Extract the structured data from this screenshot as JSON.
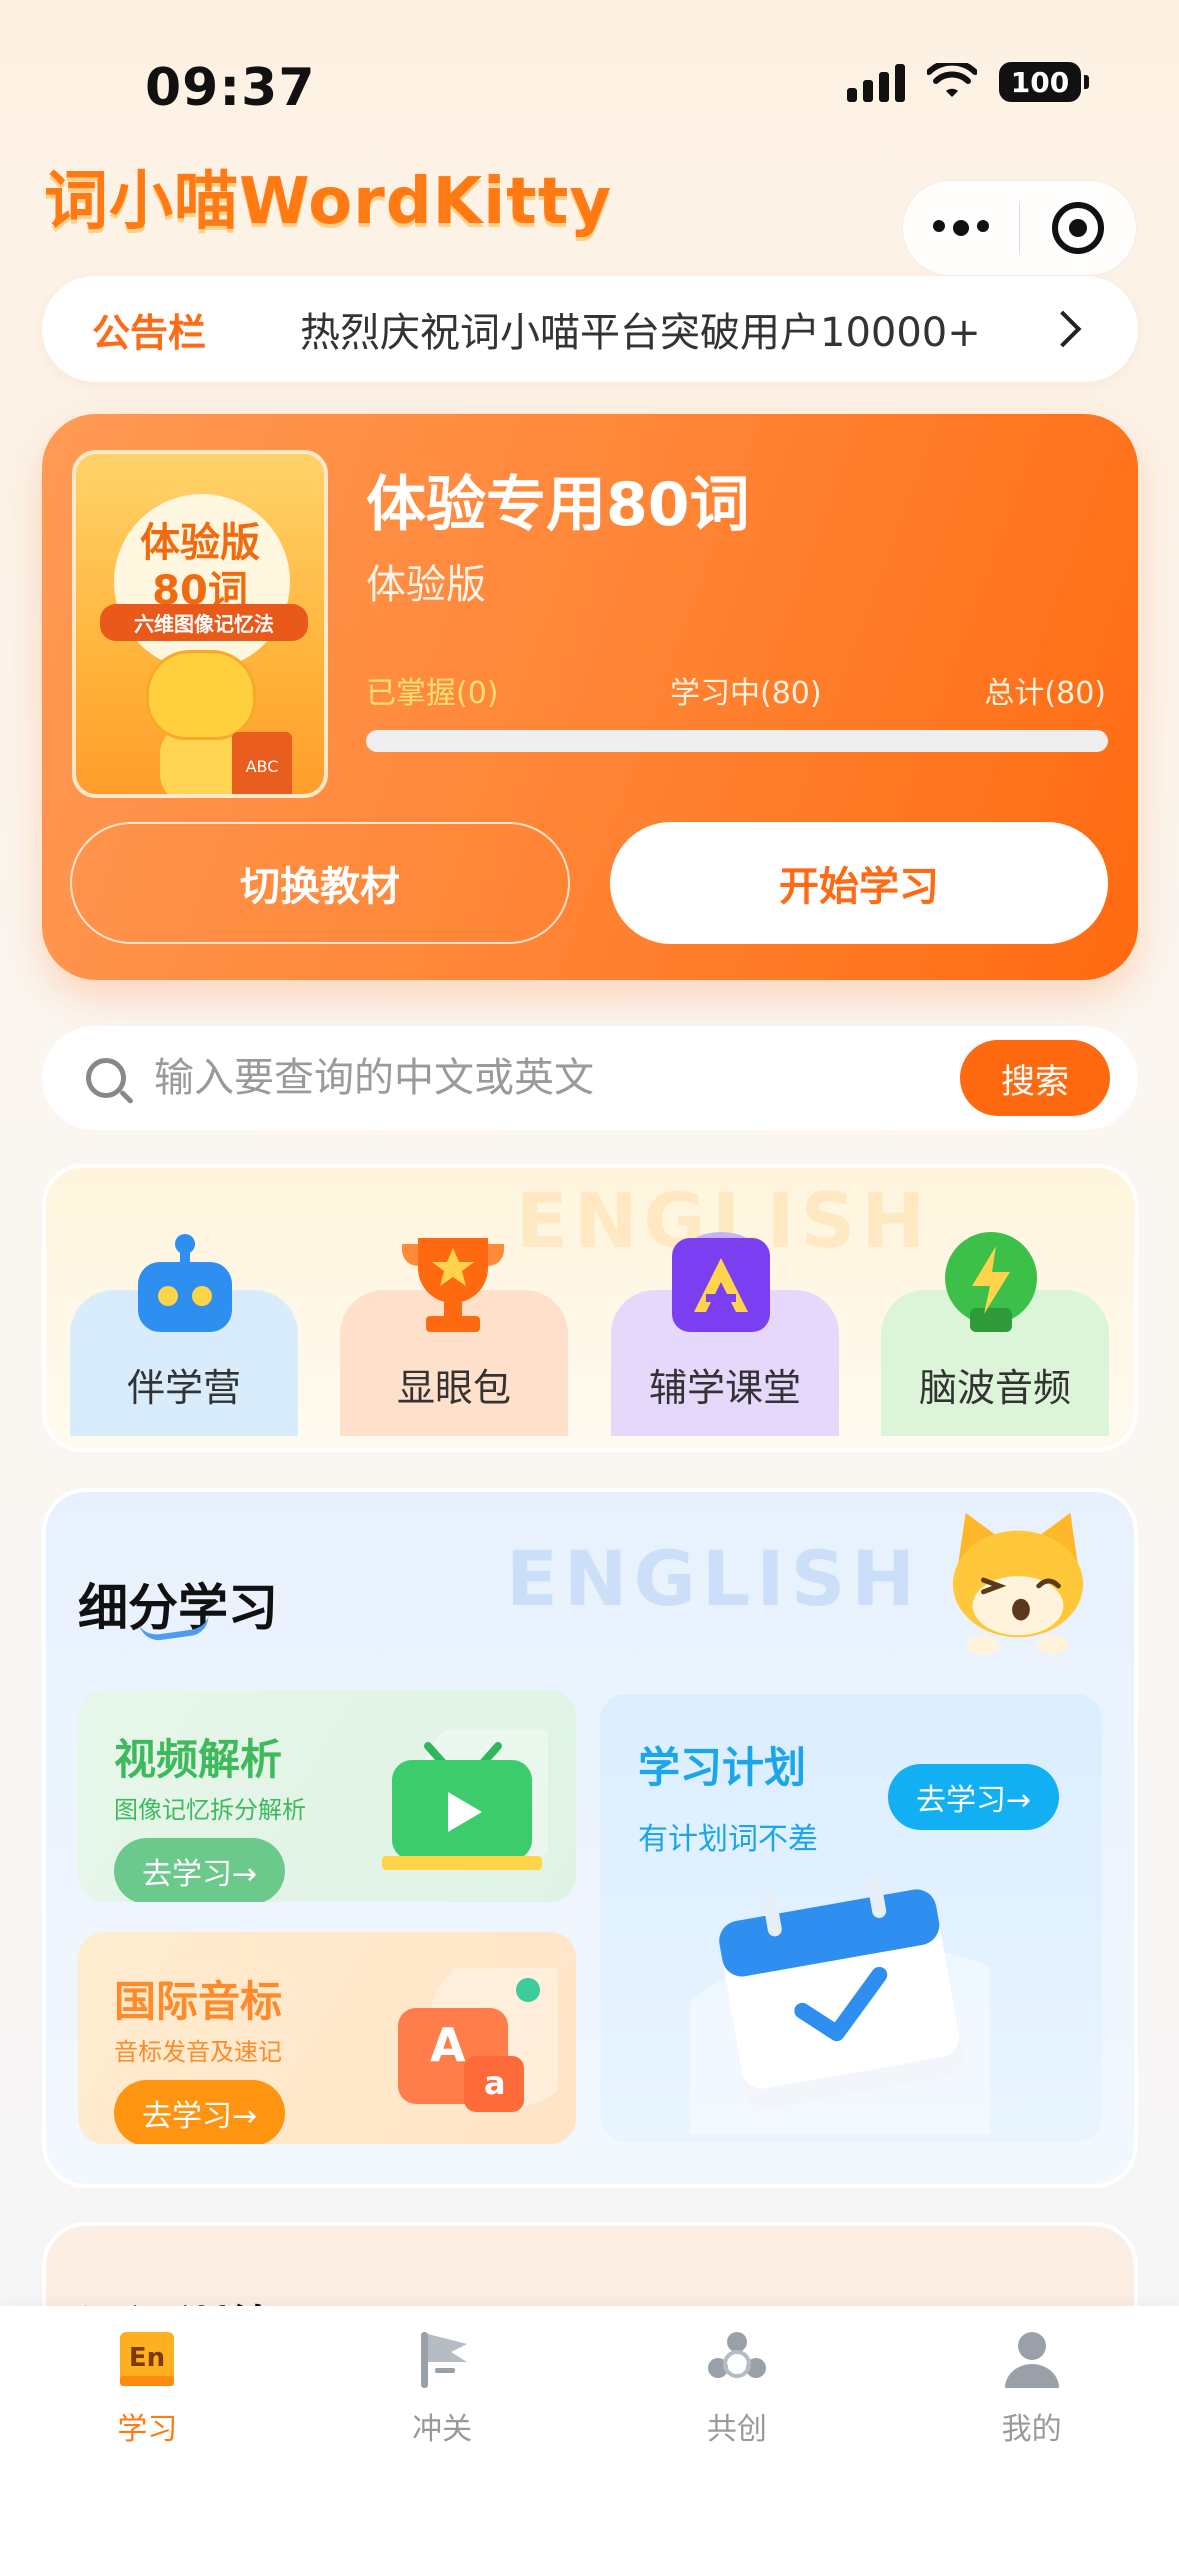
{
  "status_bar": {
    "time": "09:37",
    "battery": "100"
  },
  "header": {
    "logo": "词小喵WordKitty"
  },
  "notice": {
    "tag": "公告栏",
    "message": "热烈庆祝词小喵平台突破用户10000+"
  },
  "book": {
    "cover_title": "体验版",
    "cover_count": "80词",
    "cover_tagline": "六维图像记忆法",
    "cover_badge": "ABC",
    "title": "体验专用80词",
    "subtitle": "体验版",
    "mastered": "已掌握(0)",
    "learning": "学习中(80)",
    "total": "总计(80)",
    "progress_fraction": 0,
    "switch_label": "切换教材",
    "start_label": "开始学习"
  },
  "search": {
    "placeholder": "输入要查询的中文或英文",
    "button": "搜索"
  },
  "features": {
    "watermark": "ENGLISH",
    "items": [
      {
        "label": "伴学营",
        "icon": "robot-icon",
        "bg": "#d6ebfb",
        "color": "#2f8ff0"
      },
      {
        "label": "显眼包",
        "icon": "trophy-icon",
        "bg": "#ffdfc8",
        "color": "#ff6a10"
      },
      {
        "label": "辅学课堂",
        "icon": "course-icon",
        "bg": "#e4d7fb",
        "color": "#7a3ff0"
      },
      {
        "label": "脑波音频",
        "icon": "lightning-bulb-icon",
        "bg": "#dbf4d6",
        "color": "#3dc04a"
      }
    ]
  },
  "detail": {
    "title": "细分学习",
    "watermark": "ENGLISH",
    "video": {
      "title": "视频解析",
      "subtitle": "图像记忆拆分解析",
      "button": "去学习→"
    },
    "phonetics": {
      "title": "国际音标",
      "subtitle": "音标发音及速记",
      "button": "去学习→",
      "glyph_a": "A",
      "glyph_b": "a"
    },
    "plan": {
      "title": "学习计划",
      "subtitle": "有计划词不差",
      "button": "去学习→"
    }
  },
  "next_section": {
    "title": "词汇训练"
  },
  "tabbar": {
    "items": [
      {
        "label": "学习",
        "icon": "en-book-icon",
        "badge": "En",
        "active": true
      },
      {
        "label": "冲关",
        "icon": "flag-icon",
        "active": false
      },
      {
        "label": "共创",
        "icon": "team-icon",
        "active": false
      },
      {
        "label": "我的",
        "icon": "user-icon",
        "active": false
      }
    ]
  },
  "colors": {
    "accent": "#ff6a10",
    "brand": "#ff7a12",
    "green": "#3dbb5c",
    "blue": "#1aa5ec"
  }
}
